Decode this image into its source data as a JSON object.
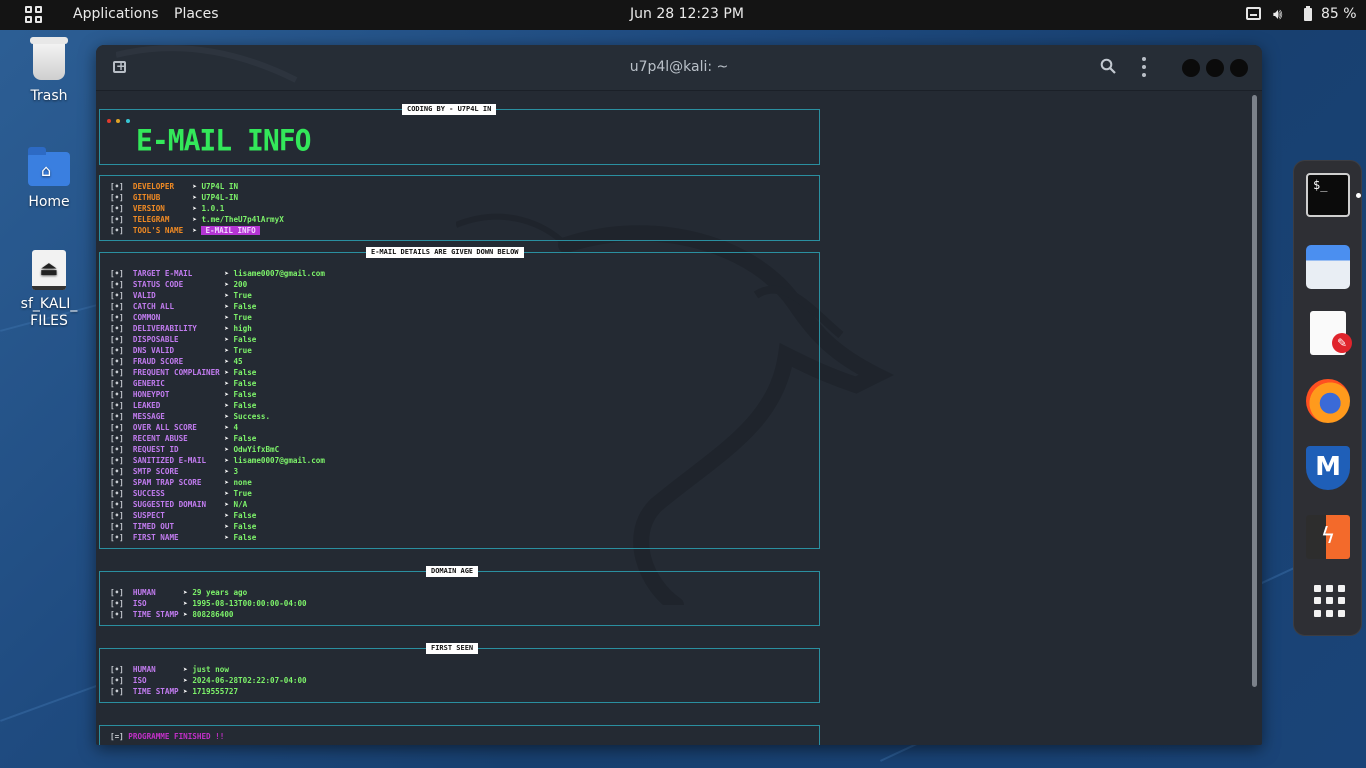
{
  "topbar": {
    "applications": "Applications",
    "places": "Places",
    "clock": "Jun 28  12:23 PM",
    "battery": "85 %"
  },
  "desktop": {
    "icons": [
      {
        "label": "Trash"
      },
      {
        "label": "Home"
      },
      {
        "label": "sf_KALI_\nFILES"
      }
    ]
  },
  "terminal": {
    "title": "u7p4l@kali: ~",
    "coding_by": "CODING BY - U7P4L IN",
    "banner": "E-MAIL INFO",
    "info": [
      {
        "bracket": "[•]",
        "key": "DEVELOPER    ",
        "value": "U7P4L IN"
      },
      {
        "bracket": "[•]",
        "key": "GITHUB       ",
        "value": "U7P4L-IN"
      },
      {
        "bracket": "[•]",
        "key": "VERSION      ",
        "value": "1.0.1"
      },
      {
        "bracket": "[•]",
        "key": "TELEGRAM     ",
        "value": "t.me/TheU7p4lArmyX"
      },
      {
        "bracket": "[•]",
        "key": "TOOL'S NAME  ",
        "value": "E-MAIL INFO"
      }
    ],
    "details_label": "E-MAIL DETAILS ARE GIVEN DOWN BELOW",
    "details": [
      {
        "key": "TARGET E-MAIL      ",
        "value": "lisame0007@gmail.com"
      },
      {
        "key": "STATUS CODE        ",
        "value": "200"
      },
      {
        "key": "VALID              ",
        "value": "True"
      },
      {
        "key": "CATCH ALL          ",
        "value": "False"
      },
      {
        "key": "COMMON             ",
        "value": "True"
      },
      {
        "key": "DELIVERABILITY     ",
        "value": "high"
      },
      {
        "key": "DISPOSABLE         ",
        "value": "False"
      },
      {
        "key": "DNS VALID          ",
        "value": "True"
      },
      {
        "key": "FRAUD SCORE        ",
        "value": "45"
      },
      {
        "key": "FREQUENT COMPLAINER",
        "value": "False"
      },
      {
        "key": "GENERIC            ",
        "value": "False"
      },
      {
        "key": "HONEYPOT           ",
        "value": "False"
      },
      {
        "key": "LEAKED             ",
        "value": "False"
      },
      {
        "key": "MESSAGE            ",
        "value": "Success."
      },
      {
        "key": "OVER ALL SCORE     ",
        "value": "4"
      },
      {
        "key": "RECENT ABUSE       ",
        "value": "False"
      },
      {
        "key": "REQUEST ID         ",
        "value": "OdwYifxBmC"
      },
      {
        "key": "SANITIZED E-MAIL   ",
        "value": "lisame0007@gmail.com"
      },
      {
        "key": "SMTP SCORE         ",
        "value": "3"
      },
      {
        "key": "SPAM TRAP SCORE    ",
        "value": "none"
      },
      {
        "key": "SUCCESS            ",
        "value": "True"
      },
      {
        "key": "SUGGESTED DOMAIN   ",
        "value": "N/A"
      },
      {
        "key": "SUSPECT            ",
        "value": "False"
      },
      {
        "key": "TIMED OUT          ",
        "value": "False"
      },
      {
        "key": "FIRST NAME         ",
        "value": "False"
      }
    ],
    "domain_age_label": "DOMAIN AGE",
    "domain_age": [
      {
        "key": "HUMAN     ",
        "value": "29 years ago"
      },
      {
        "key": "ISO       ",
        "value": "1995-08-13T00:00:00-04:00"
      },
      {
        "key": "TIME STAMP",
        "value": "808286400"
      }
    ],
    "first_seen_label": "FIRST SEEN",
    "first_seen": [
      {
        "key": "HUMAN     ",
        "value": "just now"
      },
      {
        "key": "ISO       ",
        "value": "2024-06-28T02:22:07-04:00"
      },
      {
        "key": "TIME STAMP",
        "value": "1719555727"
      }
    ],
    "finished_bracket": "[=]",
    "finished": "PROGRAMME FINISHED !!"
  },
  "colors": {
    "topbar_bg": "#141414",
    "terminal_bg": "#242a33",
    "box_border": "#2a8fa0",
    "banner_green": "#33e85a",
    "key_purple": "#c27cf0",
    "key_orange": "#f08a24",
    "value_green": "#7df36a"
  },
  "icons": [
    "grid-icon",
    "notification-icon",
    "volume-icon",
    "battery-icon",
    "new-tab-icon",
    "search-icon",
    "kebab-menu-icon"
  ]
}
